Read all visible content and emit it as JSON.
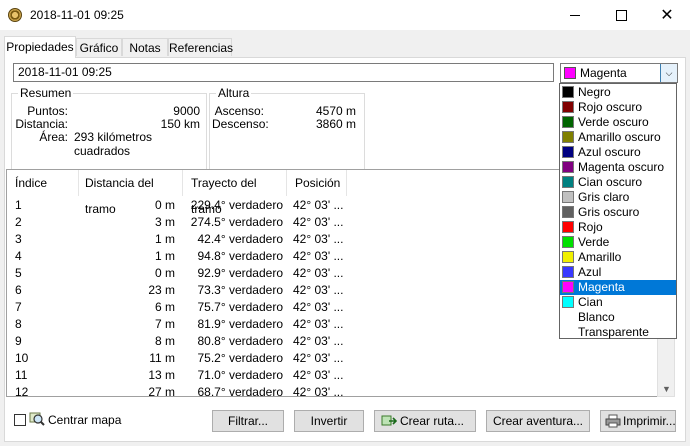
{
  "window": {
    "title": "2018-11-01 09:25"
  },
  "tabs": [
    "Propiedades",
    "Gráfico",
    "Notas",
    "Referencias"
  ],
  "track": {
    "name": "2018-11-01 09:25",
    "color_selected": "Magenta",
    "color_selected_hex": "#ff00ff"
  },
  "resumen": {
    "title": "Resumen",
    "puntos_label": "Puntos:",
    "puntos_value": "9000",
    "distancia_label": "Distancia:",
    "distancia_value": "150 km",
    "area_label": "Área:",
    "area_value": "293 kilómetros cuadrados"
  },
  "altura": {
    "title": "Altura",
    "ascenso_label": "Ascenso:",
    "ascenso_value": "4570 m",
    "descenso_label": "Descenso:",
    "descenso_value": "3860 m"
  },
  "table": {
    "columns": [
      "Índice",
      "Distancia del tramo",
      "Trayecto del tramo",
      "Posición"
    ],
    "rows": [
      [
        "1",
        "0 m",
        "229.4° verdadero",
        "42° 03' ..."
      ],
      [
        "2",
        "3 m",
        "274.5° verdadero",
        "42° 03' ..."
      ],
      [
        "3",
        "1 m",
        "42.4° verdadero",
        "42° 03' ..."
      ],
      [
        "4",
        "1 m",
        "94.8° verdadero",
        "42° 03' ..."
      ],
      [
        "5",
        "0 m",
        "92.9° verdadero",
        "42° 03' ..."
      ],
      [
        "6",
        "23 m",
        "73.3° verdadero",
        "42° 03' ..."
      ],
      [
        "7",
        "6 m",
        "75.7° verdadero",
        "42° 03' ..."
      ],
      [
        "8",
        "7 m",
        "81.9° verdadero",
        "42° 03' ..."
      ],
      [
        "9",
        "8 m",
        "80.8° verdadero",
        "42° 03' ..."
      ],
      [
        "10",
        "11 m",
        "75.2° verdadero",
        "42° 03' ..."
      ],
      [
        "11",
        "13 m",
        "71.0° verdadero",
        "42° 03' ..."
      ],
      [
        "12",
        "27 m",
        "68.7° verdadero",
        "42° 03' ..."
      ]
    ]
  },
  "bottom": {
    "centrar_label": "Centrar mapa",
    "filtrar": "Filtrar...",
    "invertir": "Invertir",
    "crear_ruta": "Crear ruta...",
    "crear_aventura": "Crear aventura...",
    "imprimir": "Imprimir..."
  },
  "colors": [
    {
      "name": "Negro",
      "hex": "#000000"
    },
    {
      "name": "Rojo oscuro",
      "hex": "#800000"
    },
    {
      "name": "Verde oscuro",
      "hex": "#006400"
    },
    {
      "name": "Amarillo oscuro",
      "hex": "#808000"
    },
    {
      "name": "Azul oscuro",
      "hex": "#000080"
    },
    {
      "name": "Magenta oscuro",
      "hex": "#800080"
    },
    {
      "name": "Cian oscuro",
      "hex": "#008080"
    },
    {
      "name": "Gris claro",
      "hex": "#c0c0c0"
    },
    {
      "name": "Gris oscuro",
      "hex": "#606060"
    },
    {
      "name": "Rojo",
      "hex": "#ff0000"
    },
    {
      "name": "Verde",
      "hex": "#00e000"
    },
    {
      "name": "Amarillo",
      "hex": "#f0f000"
    },
    {
      "name": "Azul",
      "hex": "#3838ff"
    },
    {
      "name": "Magenta",
      "hex": "#ff00ff",
      "selected": true
    },
    {
      "name": "Cian",
      "hex": "#00ffff"
    },
    {
      "name": "Blanco",
      "hex": ""
    },
    {
      "name": "Transparente",
      "hex": ""
    }
  ]
}
